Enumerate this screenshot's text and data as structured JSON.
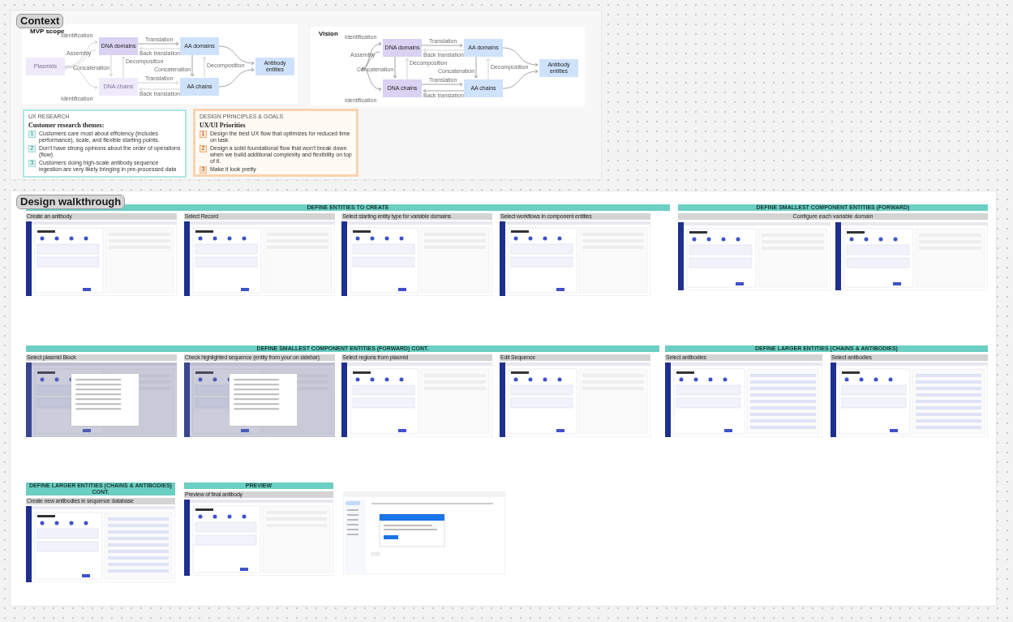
{
  "context": {
    "title": "Context",
    "diagrams": [
      {
        "title": "MVP scope",
        "nodes": [
          {
            "kind": "source",
            "label": "Plasmids",
            "dimmed": true
          },
          {
            "kind": "dna_domain",
            "label": "DNA domains",
            "dimmed": false
          },
          {
            "kind": "aa_domain",
            "label": "AA domains",
            "dimmed": false
          },
          {
            "kind": "dna_chain",
            "label": "DNA chains",
            "dimmed": true
          },
          {
            "kind": "aa_chain",
            "label": "AA chains",
            "dimmed": false
          },
          {
            "kind": "target",
            "label": "Antibody entities",
            "dimmed": false
          }
        ],
        "edge_labels": [
          "Identification",
          "Assembly",
          "Concatenation",
          "Identification",
          "Translation",
          "Back translation",
          "Decomposition",
          "Concatenation",
          "Decomposition",
          "Translation",
          "Back translation"
        ]
      },
      {
        "title": "Vision",
        "nodes": [
          {
            "kind": "dna_domain",
            "label": "DNA domains",
            "dimmed": false
          },
          {
            "kind": "aa_domain",
            "label": "AA domains",
            "dimmed": false
          },
          {
            "kind": "dna_chain",
            "label": "DNA chains",
            "dimmed": false
          },
          {
            "kind": "aa_chain",
            "label": "AA chains",
            "dimmed": false
          },
          {
            "kind": "target",
            "label": "Antibody entities",
            "dimmed": false
          }
        ],
        "edge_labels": [
          "Identification",
          "Assembly",
          "Concatenation",
          "Identification",
          "Translation",
          "Back translation",
          "Decomposition",
          "Concatenation",
          "Decomposition",
          "Translation",
          "Back translation"
        ]
      }
    ],
    "notes": [
      {
        "kind": "research",
        "overline": "UX RESEARCH",
        "title": "Customer research themes:",
        "items": [
          {
            "number": "1",
            "text": "Customers care most about efficiency (includes performance), scale, and flexible starting points."
          },
          {
            "number": "2",
            "text": "Don't have strong opinions about the order of operations (flow)"
          },
          {
            "number": "3",
            "text": "Customers doing high-scale antibody sequence ingestion are very likely bringing in pre-processed data"
          }
        ]
      },
      {
        "kind": "priorities",
        "overline": "DESIGN PRINCIPLES & GOALS",
        "title": "UX/UI Priorities",
        "items": [
          {
            "number": "1",
            "text": "Design the best UX flow that optimizes for reduced time on task"
          },
          {
            "number": "2",
            "text": "Design a solid foundational flow that won't break down when we build additional complexity and flexibility on top of it."
          },
          {
            "number": "3",
            "text": "Make it look pretty"
          }
        ]
      }
    ]
  },
  "walkthrough": {
    "title": "Design walkthrough",
    "sections": [
      {
        "title": "DEFINE ENTITIES TO CREATE",
        "frames": [
          {
            "label": "Create an antibody",
            "kind": "list"
          },
          {
            "label": "Select Record",
            "kind": "form"
          },
          {
            "label": "Select starting entity type for variable domains",
            "kind": "form"
          },
          {
            "label": "Select workflows in component entities",
            "kind": "form"
          }
        ]
      },
      {
        "title": "DEFINE SMALLEST COMPONENT ENTITIES (FORWARD)",
        "subheader": "Configure each variable domain",
        "frames": [
          {
            "kind": "form"
          },
          {
            "kind": "form"
          }
        ]
      },
      {
        "title": "DEFINE SMALLEST COMPONENT ENTITIES (FORWARD) CONT.",
        "frames": [
          {
            "label": "Select plasmid Block",
            "kind": "modal"
          },
          {
            "label": "Check highlighted sequence (entity from your on sidebar)",
            "kind": "modal"
          },
          {
            "label": "Select regions from plasmid",
            "kind": "form"
          },
          {
            "label": "Edit Sequence",
            "kind": "form"
          }
        ]
      },
      {
        "title": "DEFINE LARGER ENTITIES (CHAINS & ANTIBODIES)",
        "frames": [
          {
            "label": "Select antibodies",
            "kind": "table"
          },
          {
            "label": "Select antibodies",
            "kind": "table"
          }
        ]
      },
      {
        "title": "DEFINE LARGER ENTITIES (CHAINS & ANTIBODIES) CONT.",
        "frames": [
          {
            "label": "Create new antibodies in sequence database",
            "kind": "table"
          }
        ]
      },
      {
        "title": "PREVIEW",
        "frames": [
          {
            "label": "Preview of final antibody",
            "kind": "form"
          }
        ]
      }
    ],
    "loose_frames": [
      {
        "kind": "email"
      }
    ]
  }
}
